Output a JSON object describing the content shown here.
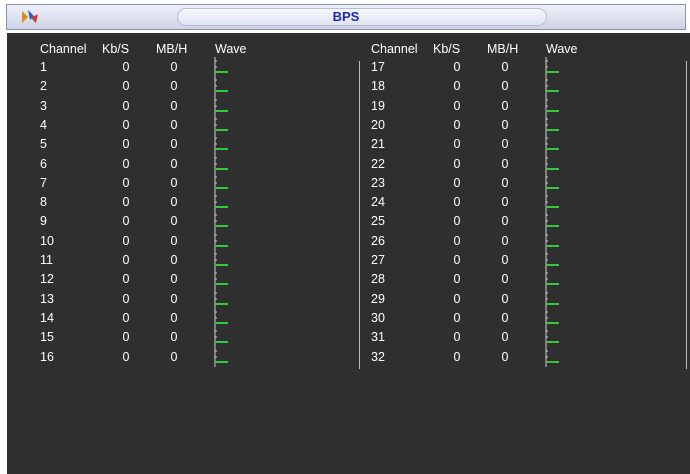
{
  "window": {
    "title": "BPS"
  },
  "columns": {
    "channel": "Channel",
    "kbs": "Kb/S",
    "mbh": "MB/H",
    "wave": "Wave"
  },
  "colors": {
    "wave": "#35c83a",
    "panel": "#2f2f2f",
    "title": "#1a2aa8"
  },
  "icons": {
    "logo": "logo-icon"
  },
  "left_rows": [
    {
      "channel": "1",
      "kbs": "0",
      "mbh": "0"
    },
    {
      "channel": "2",
      "kbs": "0",
      "mbh": "0"
    },
    {
      "channel": "3",
      "kbs": "0",
      "mbh": "0"
    },
    {
      "channel": "4",
      "kbs": "0",
      "mbh": "0"
    },
    {
      "channel": "5",
      "kbs": "0",
      "mbh": "0"
    },
    {
      "channel": "6",
      "kbs": "0",
      "mbh": "0"
    },
    {
      "channel": "7",
      "kbs": "0",
      "mbh": "0"
    },
    {
      "channel": "8",
      "kbs": "0",
      "mbh": "0"
    },
    {
      "channel": "9",
      "kbs": "0",
      "mbh": "0"
    },
    {
      "channel": "10",
      "kbs": "0",
      "mbh": "0"
    },
    {
      "channel": "11",
      "kbs": "0",
      "mbh": "0"
    },
    {
      "channel": "12",
      "kbs": "0",
      "mbh": "0"
    },
    {
      "channel": "13",
      "kbs": "0",
      "mbh": "0"
    },
    {
      "channel": "14",
      "kbs": "0",
      "mbh": "0"
    },
    {
      "channel": "15",
      "kbs": "0",
      "mbh": "0"
    },
    {
      "channel": "16",
      "kbs": "0",
      "mbh": "0"
    }
  ],
  "right_rows": [
    {
      "channel": "17",
      "kbs": "0",
      "mbh": "0"
    },
    {
      "channel": "18",
      "kbs": "0",
      "mbh": "0"
    },
    {
      "channel": "19",
      "kbs": "0",
      "mbh": "0"
    },
    {
      "channel": "20",
      "kbs": "0",
      "mbh": "0"
    },
    {
      "channel": "21",
      "kbs": "0",
      "mbh": "0"
    },
    {
      "channel": "22",
      "kbs": "0",
      "mbh": "0"
    },
    {
      "channel": "23",
      "kbs": "0",
      "mbh": "0"
    },
    {
      "channel": "24",
      "kbs": "0",
      "mbh": "0"
    },
    {
      "channel": "25",
      "kbs": "0",
      "mbh": "0"
    },
    {
      "channel": "26",
      "kbs": "0",
      "mbh": "0"
    },
    {
      "channel": "27",
      "kbs": "0",
      "mbh": "0"
    },
    {
      "channel": "28",
      "kbs": "0",
      "mbh": "0"
    },
    {
      "channel": "29",
      "kbs": "0",
      "mbh": "0"
    },
    {
      "channel": "30",
      "kbs": "0",
      "mbh": "0"
    },
    {
      "channel": "31",
      "kbs": "0",
      "mbh": "0"
    },
    {
      "channel": "32",
      "kbs": "0",
      "mbh": "0"
    }
  ]
}
